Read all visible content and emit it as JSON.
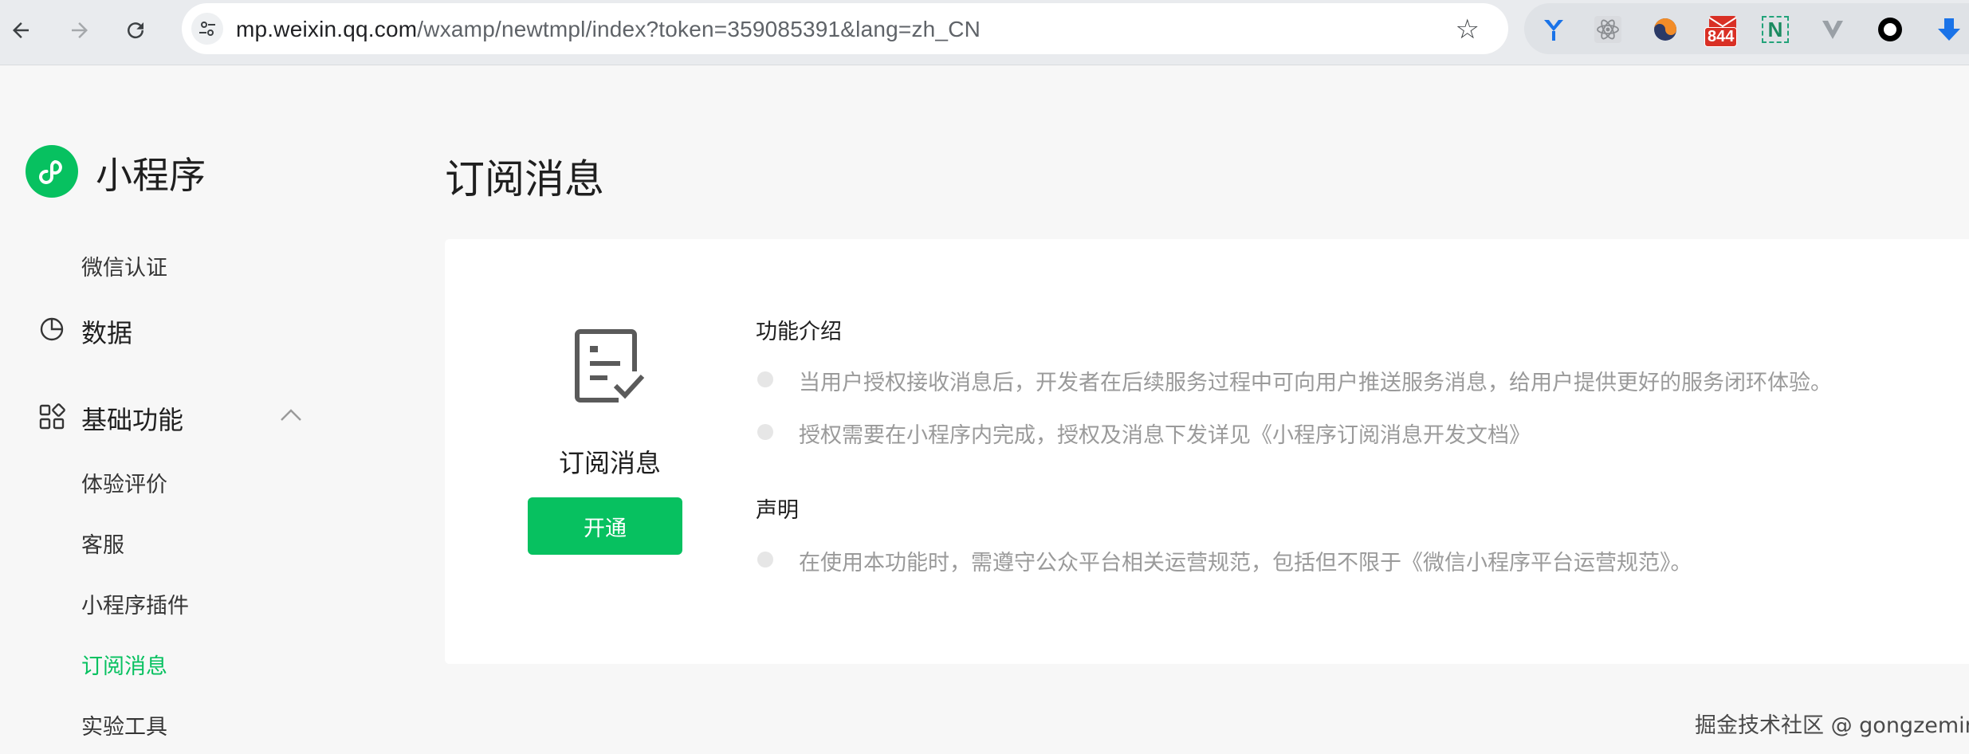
{
  "browser": {
    "url_host": "mp.weixin.qq.com",
    "url_path": "/wxamp/newtmpl/index?token=359085391&lang=zh_CN",
    "extension_badge": "844",
    "extension_letter": "N"
  },
  "sidebar": {
    "logo_text": "小程序",
    "items": {
      "wechat_auth": "微信认证",
      "data": "数据",
      "basic_features": "基础功能",
      "experience_rating": "体验评价",
      "customer_service": "客服",
      "plugins": "小程序插件",
      "subscribe_message": "订阅消息",
      "lab_tools": "实验工具"
    }
  },
  "main": {
    "title": "订阅消息",
    "card": {
      "feature_name": "订阅消息",
      "open_button": "开通",
      "intro_title": "功能介绍",
      "intro_points": [
        "当用户授权接收消息后，开发者在后续服务过程中可向用户推送服务消息，给用户提供更好的服务闭环体验。",
        "授权需要在小程序内完成，授权及消息下发详见《小程序订阅消息开发文档》"
      ],
      "statement_title": "声明",
      "statement_points": [
        "在使用本功能时，需遵守公众平台相关运营规范，包括但不限于《微信小程序平台运营规范》。"
      ]
    }
  },
  "watermark": "掘金技术社区 @ gongzemin",
  "colors": {
    "brand_green": "#07c160",
    "page_bg": "#f7f7f7",
    "card_bg": "#ffffff",
    "muted_text": "#9a9a9a"
  }
}
